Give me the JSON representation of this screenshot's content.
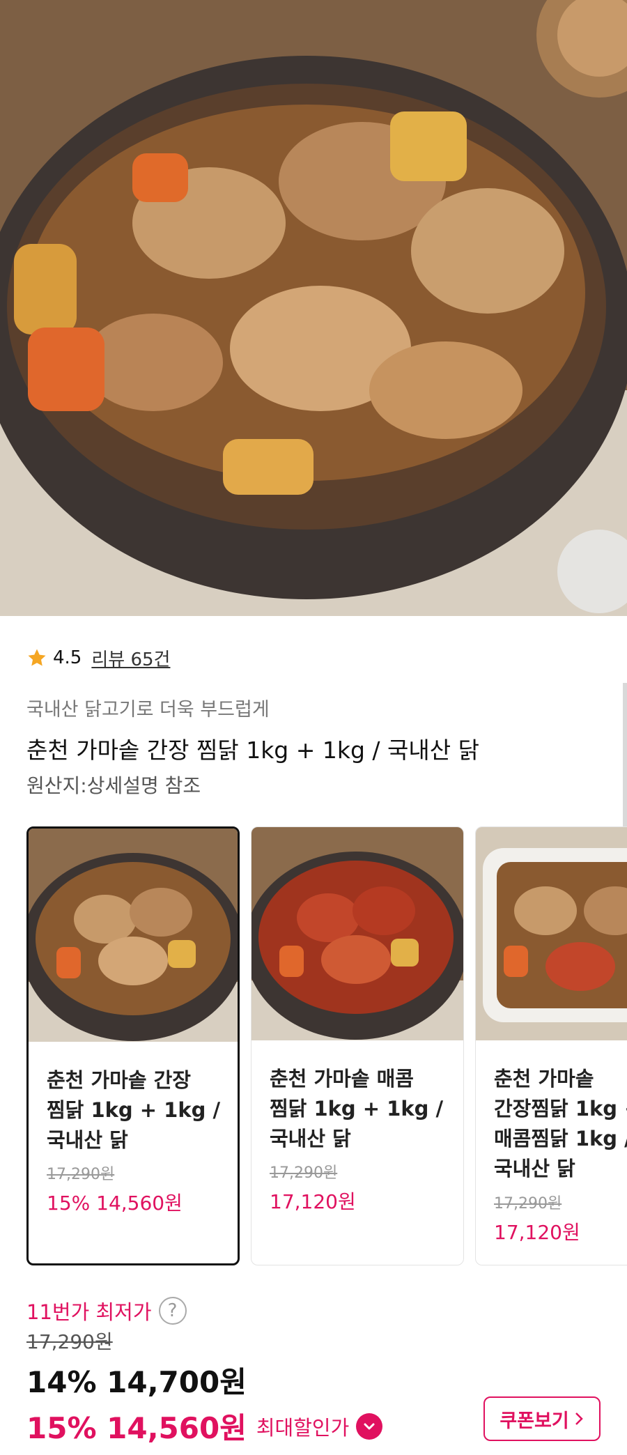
{
  "rating": {
    "score": "4.5",
    "review": "리뷰 65건"
  },
  "product": {
    "subtitle": "국내산 닭고기로 더욱 부드럽게",
    "title": "춘천 가마솥 간장 찜닭 1kg + 1kg / 국내산 닭",
    "origin": "원산지:상세설명 참조"
  },
  "options": [
    {
      "name": "춘천 가마솥 간장\n찜닭 1kg + 1kg /\n국내산 닭",
      "orig_price": "17,290원",
      "price": "15% 14,560원",
      "selected": true
    },
    {
      "name": "춘천 가마솥 매콤\n찜닭 1kg + 1kg /\n국내산 닭",
      "orig_price": "17,290원",
      "price": "17,120원",
      "selected": false
    },
    {
      "name": "춘천 가마솥\n간장찜닭 1kg +\n매콤찜닭 1kg /\n국내산 닭",
      "orig_price": "17,290원",
      "price": "17,120원",
      "selected": false
    }
  ],
  "pricing": {
    "lowest_label": "11번가 최저가",
    "help_icon": "?",
    "original": "17,290원",
    "discount_main": "14% 14,700원",
    "max_discount": "15% 14,560원",
    "max_label": "최대할인가",
    "coupon_button": "쿠폰보기"
  },
  "colors": {
    "accent": "#e0115f",
    "star": "#f5a623"
  },
  "icons": {
    "rating": "star-icon",
    "help": "question-icon",
    "chevron": "chevron-down-icon",
    "coupon_arrow": "chevron-right-icon"
  }
}
